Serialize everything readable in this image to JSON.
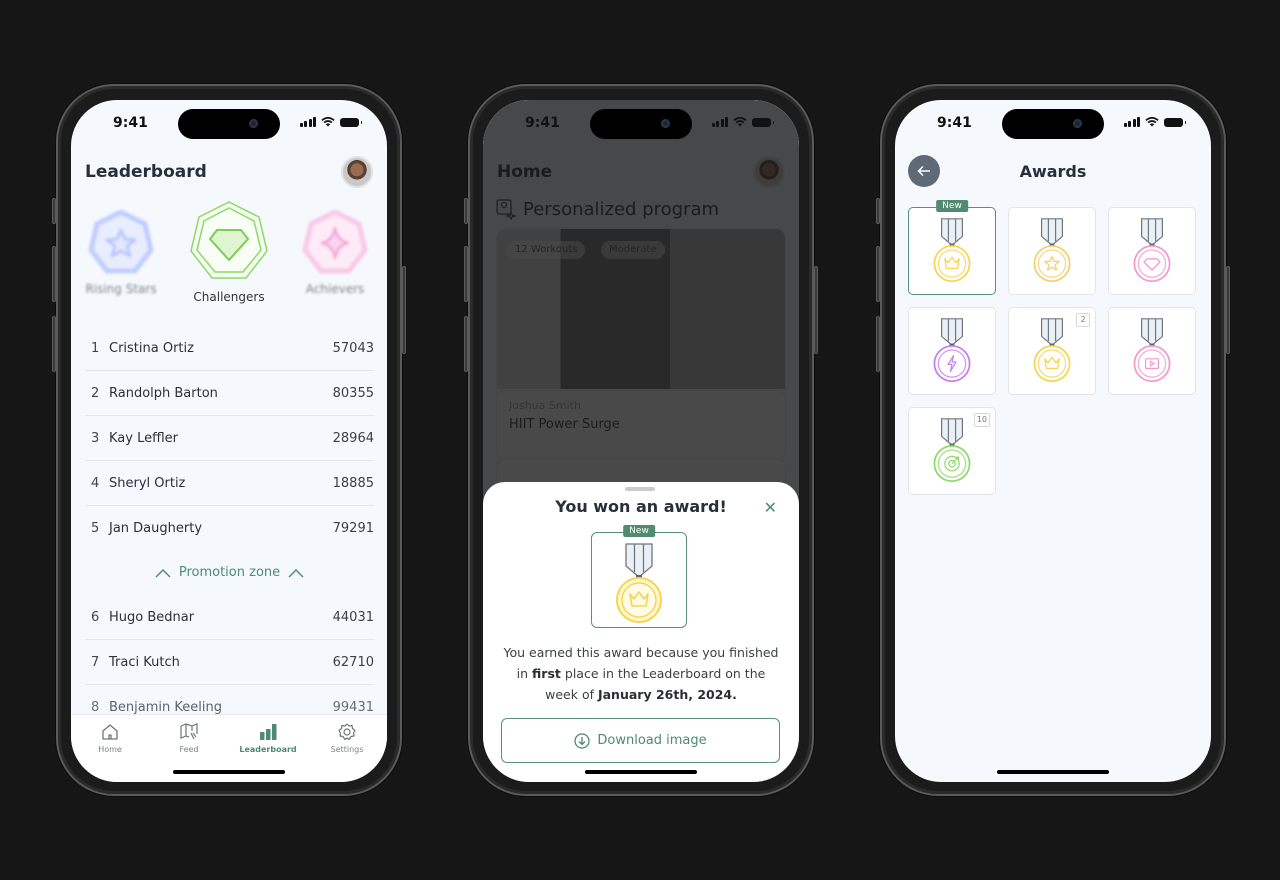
{
  "status_bar": {
    "time": "9:41"
  },
  "leaderboard": {
    "title": "Leaderboard",
    "leagues": [
      {
        "name": "Rising Stars",
        "color": "#a9b9ff",
        "state": "inactive"
      },
      {
        "name": "Challengers",
        "color": "#8fd86a",
        "state": "current"
      },
      {
        "name": "Achievers",
        "color": "#f7a6d8",
        "state": "inactive"
      }
    ],
    "rows_top": [
      {
        "rank": "1",
        "name": "Cristina Ortiz",
        "score": "57043"
      },
      {
        "rank": "2",
        "name": "Randolph Barton",
        "score": "80355"
      },
      {
        "rank": "3",
        "name": "Kay Leffler",
        "score": "28964"
      },
      {
        "rank": "4",
        "name": "Sheryl Ortiz",
        "score": "18885"
      },
      {
        "rank": "5",
        "name": "Jan Daugherty",
        "score": "79291"
      }
    ],
    "promotion_label": "Promotion zone",
    "rows_bottom": [
      {
        "rank": "6",
        "name": "Hugo Bednar",
        "score": "44031"
      },
      {
        "rank": "7",
        "name": "Traci Kutch",
        "score": "62710"
      },
      {
        "rank": "8",
        "name": "Benjamin Keeling",
        "score": "99431"
      }
    ],
    "tabs": [
      {
        "label": "Home",
        "icon": "home-icon"
      },
      {
        "label": "Feed",
        "icon": "map-icon"
      },
      {
        "label": "Leaderboard",
        "icon": "bar-chart-icon",
        "active": true
      },
      {
        "label": "Settings",
        "icon": "gear-icon"
      }
    ]
  },
  "home": {
    "title": "Home",
    "section_title": "Personalized program",
    "chips": [
      "12 Workouts",
      "Moderate"
    ],
    "card_author": "Joshua Smith",
    "card_title": "HIIT Power Surge"
  },
  "modal": {
    "title": "You won an award!",
    "badge": "New",
    "desc_1": "You earned this award because you finished in ",
    "desc_bold_1": "first",
    "desc_2": " place in the Leaderboard on the week of ",
    "desc_bold_2": "January 26th, 2024.",
    "download_label": "Download image"
  },
  "awards": {
    "title": "Awards",
    "new_badge": "New",
    "items": [
      {
        "icon": "crown-icon",
        "color": "#f6d552",
        "new": true,
        "count": ""
      },
      {
        "icon": "star-icon",
        "color": "#f5cf6e",
        "new": false,
        "count": ""
      },
      {
        "icon": "diamond-icon",
        "color": "#f39ad0",
        "new": false,
        "count": ""
      },
      {
        "icon": "bolt-icon",
        "color": "#c780ea",
        "new": false,
        "count": ""
      },
      {
        "icon": "crown-icon",
        "color": "#f6d552",
        "new": false,
        "count": "2"
      },
      {
        "icon": "video-icon",
        "color": "#f39ad0",
        "new": false,
        "count": ""
      },
      {
        "icon": "target-icon",
        "color": "#8fd86a",
        "new": false,
        "count": "10"
      }
    ]
  },
  "colors": {
    "accent": "#4e8a70",
    "background": "#161616",
    "screen": "#f5f9fe"
  }
}
